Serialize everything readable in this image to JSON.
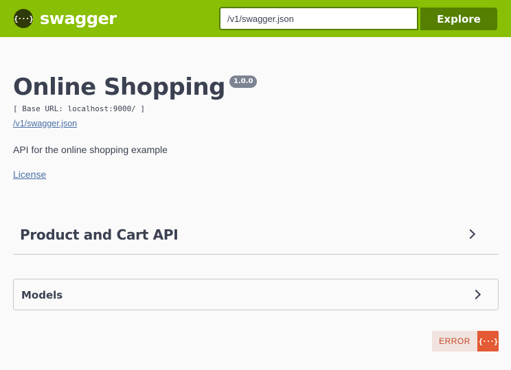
{
  "topbar": {
    "logo_mark": "{···}",
    "logo_text": "swagger",
    "url_value": "/v1/swagger.json",
    "explore_label": "Explore",
    "background_color": "#89bf04"
  },
  "info": {
    "title": "Online Shopping",
    "version": "1.0.0",
    "base_url": "[ Base URL: localhost:9000/ ]",
    "spec_link": "/v1/swagger.json",
    "description": "API for the online shopping example",
    "license_label": "License"
  },
  "tags": [
    {
      "name": "Product and Cart API",
      "icon": "chevron-right-icon"
    }
  ],
  "models": {
    "label": "Models",
    "icon": "chevron-right-icon"
  },
  "validator": {
    "label": "ERROR",
    "icon_text": "{···}",
    "color": "#e35a35"
  }
}
